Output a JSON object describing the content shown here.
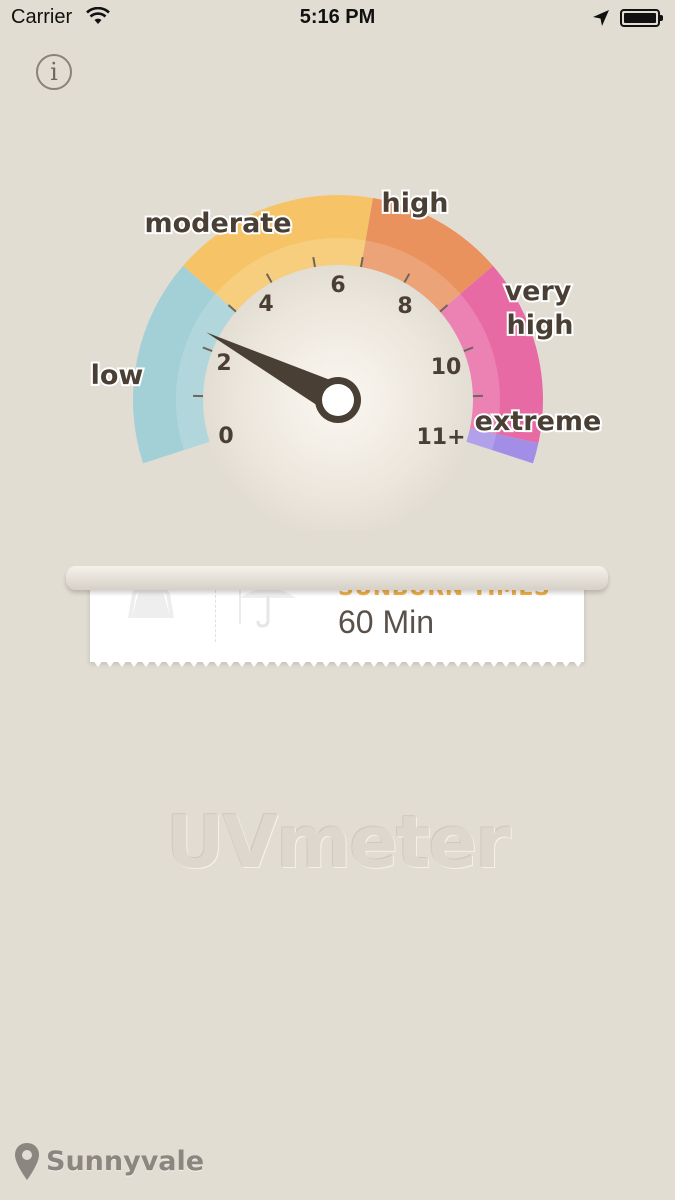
{
  "status_bar": {
    "carrier": "Carrier",
    "time": "5:16 PM"
  },
  "info_button": {
    "label": "i"
  },
  "gauge": {
    "value": 2.3,
    "min": 0,
    "max": 11,
    "bands": [
      {
        "name": "low",
        "color": "#a3d0d6"
      },
      {
        "name": "moderate",
        "color": "#f6c466"
      },
      {
        "name": "high",
        "color": "#e9925d"
      },
      {
        "name": "very high",
        "color": "#e76aa5"
      },
      {
        "name": "extreme",
        "color": "#a28ee6"
      }
    ],
    "tick_labels": [
      "0",
      "2",
      "4",
      "6",
      "8",
      "10",
      "11+"
    ],
    "band_labels": {
      "low": "low",
      "moderate": "moderate",
      "high": "high",
      "very_line1": "very",
      "very_line2": "high",
      "extreme": "extreme"
    }
  },
  "ticket": {
    "title": "SUNBURN TIMES",
    "value": "60 Min"
  },
  "logo": "UVmeter",
  "location": {
    "name": "Sunnyvale"
  }
}
